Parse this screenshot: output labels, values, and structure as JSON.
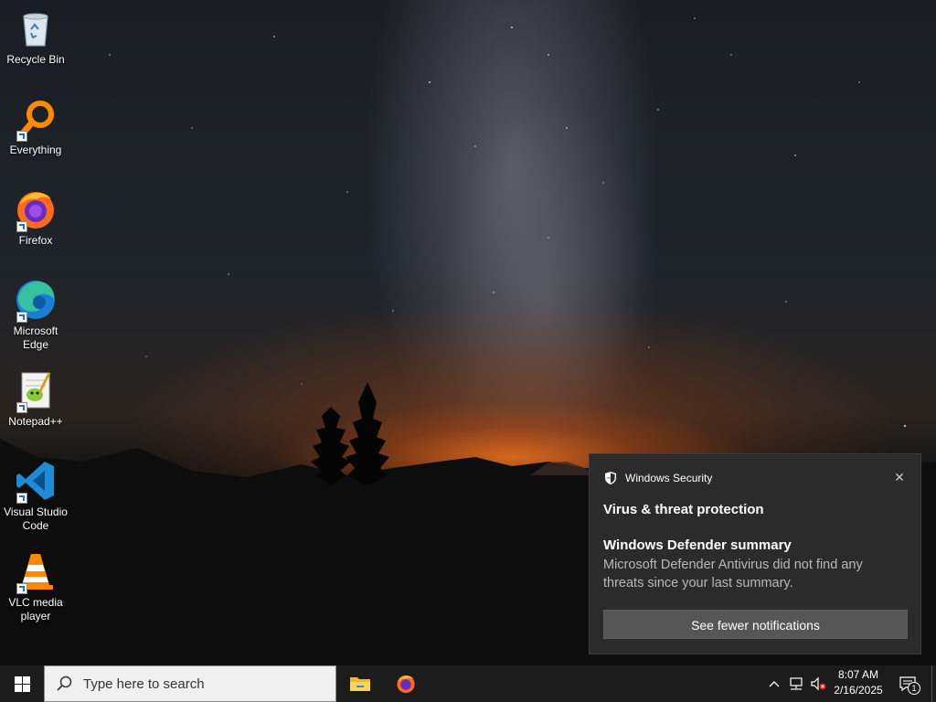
{
  "desktop": {
    "icons": [
      {
        "label": "Recycle Bin",
        "icon": "recycle-bin-icon"
      },
      {
        "label": "Everything",
        "icon": "everything-search-icon"
      },
      {
        "label": "Firefox",
        "icon": "firefox-icon"
      },
      {
        "label": "Microsoft Edge",
        "icon": "edge-icon"
      },
      {
        "label": "Notepad++",
        "icon": "notepad-plus-plus-icon"
      },
      {
        "label": "Visual Studio Code",
        "icon": "vscode-icon"
      },
      {
        "label": "VLC media player",
        "icon": "vlc-icon"
      }
    ]
  },
  "toast": {
    "app_name": "Windows Security",
    "title": "Virus & threat protection",
    "subtitle": "Windows Defender summary",
    "body": "Microsoft Defender Antivirus did not find any threats since your last summary.",
    "button_label": "See fewer notifications",
    "close_glyph": "✕"
  },
  "taskbar": {
    "search_placeholder": "Type here to search",
    "pinned": [
      "file-explorer-icon",
      "firefox-icon"
    ],
    "tray": {
      "time": "8:07 AM",
      "date": "2/16/2025",
      "notification_count": "1"
    }
  },
  "colors": {
    "taskbar_bg": "#1c1c1c",
    "toast_bg": "#2b2b2b",
    "toast_button": "#565656"
  }
}
